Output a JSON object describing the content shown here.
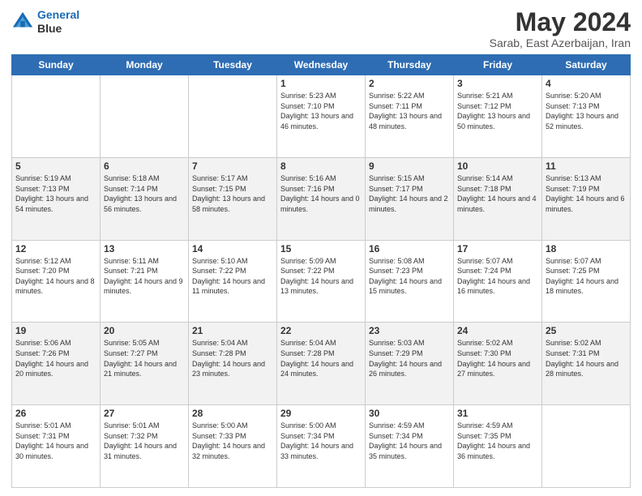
{
  "logo": {
    "line1": "General",
    "line2": "Blue"
  },
  "title": "May 2024",
  "subtitle": "Sarab, East Azerbaijan, Iran",
  "days_header": [
    "Sunday",
    "Monday",
    "Tuesday",
    "Wednesday",
    "Thursday",
    "Friday",
    "Saturday"
  ],
  "weeks": [
    [
      {
        "day": "",
        "sunrise": "",
        "sunset": "",
        "daylight": ""
      },
      {
        "day": "",
        "sunrise": "",
        "sunset": "",
        "daylight": ""
      },
      {
        "day": "",
        "sunrise": "",
        "sunset": "",
        "daylight": ""
      },
      {
        "day": "1",
        "sunrise": "Sunrise: 5:23 AM",
        "sunset": "Sunset: 7:10 PM",
        "daylight": "Daylight: 13 hours and 46 minutes."
      },
      {
        "day": "2",
        "sunrise": "Sunrise: 5:22 AM",
        "sunset": "Sunset: 7:11 PM",
        "daylight": "Daylight: 13 hours and 48 minutes."
      },
      {
        "day": "3",
        "sunrise": "Sunrise: 5:21 AM",
        "sunset": "Sunset: 7:12 PM",
        "daylight": "Daylight: 13 hours and 50 minutes."
      },
      {
        "day": "4",
        "sunrise": "Sunrise: 5:20 AM",
        "sunset": "Sunset: 7:13 PM",
        "daylight": "Daylight: 13 hours and 52 minutes."
      }
    ],
    [
      {
        "day": "5",
        "sunrise": "Sunrise: 5:19 AM",
        "sunset": "Sunset: 7:13 PM",
        "daylight": "Daylight: 13 hours and 54 minutes."
      },
      {
        "day": "6",
        "sunrise": "Sunrise: 5:18 AM",
        "sunset": "Sunset: 7:14 PM",
        "daylight": "Daylight: 13 hours and 56 minutes."
      },
      {
        "day": "7",
        "sunrise": "Sunrise: 5:17 AM",
        "sunset": "Sunset: 7:15 PM",
        "daylight": "Daylight: 13 hours and 58 minutes."
      },
      {
        "day": "8",
        "sunrise": "Sunrise: 5:16 AM",
        "sunset": "Sunset: 7:16 PM",
        "daylight": "Daylight: 14 hours and 0 minutes."
      },
      {
        "day": "9",
        "sunrise": "Sunrise: 5:15 AM",
        "sunset": "Sunset: 7:17 PM",
        "daylight": "Daylight: 14 hours and 2 minutes."
      },
      {
        "day": "10",
        "sunrise": "Sunrise: 5:14 AM",
        "sunset": "Sunset: 7:18 PM",
        "daylight": "Daylight: 14 hours and 4 minutes."
      },
      {
        "day": "11",
        "sunrise": "Sunrise: 5:13 AM",
        "sunset": "Sunset: 7:19 PM",
        "daylight": "Daylight: 14 hours and 6 minutes."
      }
    ],
    [
      {
        "day": "12",
        "sunrise": "Sunrise: 5:12 AM",
        "sunset": "Sunset: 7:20 PM",
        "daylight": "Daylight: 14 hours and 8 minutes."
      },
      {
        "day": "13",
        "sunrise": "Sunrise: 5:11 AM",
        "sunset": "Sunset: 7:21 PM",
        "daylight": "Daylight: 14 hours and 9 minutes."
      },
      {
        "day": "14",
        "sunrise": "Sunrise: 5:10 AM",
        "sunset": "Sunset: 7:22 PM",
        "daylight": "Daylight: 14 hours and 11 minutes."
      },
      {
        "day": "15",
        "sunrise": "Sunrise: 5:09 AM",
        "sunset": "Sunset: 7:22 PM",
        "daylight": "Daylight: 14 hours and 13 minutes."
      },
      {
        "day": "16",
        "sunrise": "Sunrise: 5:08 AM",
        "sunset": "Sunset: 7:23 PM",
        "daylight": "Daylight: 14 hours and 15 minutes."
      },
      {
        "day": "17",
        "sunrise": "Sunrise: 5:07 AM",
        "sunset": "Sunset: 7:24 PM",
        "daylight": "Daylight: 14 hours and 16 minutes."
      },
      {
        "day": "18",
        "sunrise": "Sunrise: 5:07 AM",
        "sunset": "Sunset: 7:25 PM",
        "daylight": "Daylight: 14 hours and 18 minutes."
      }
    ],
    [
      {
        "day": "19",
        "sunrise": "Sunrise: 5:06 AM",
        "sunset": "Sunset: 7:26 PM",
        "daylight": "Daylight: 14 hours and 20 minutes."
      },
      {
        "day": "20",
        "sunrise": "Sunrise: 5:05 AM",
        "sunset": "Sunset: 7:27 PM",
        "daylight": "Daylight: 14 hours and 21 minutes."
      },
      {
        "day": "21",
        "sunrise": "Sunrise: 5:04 AM",
        "sunset": "Sunset: 7:28 PM",
        "daylight": "Daylight: 14 hours and 23 minutes."
      },
      {
        "day": "22",
        "sunrise": "Sunrise: 5:04 AM",
        "sunset": "Sunset: 7:28 PM",
        "daylight": "Daylight: 14 hours and 24 minutes."
      },
      {
        "day": "23",
        "sunrise": "Sunrise: 5:03 AM",
        "sunset": "Sunset: 7:29 PM",
        "daylight": "Daylight: 14 hours and 26 minutes."
      },
      {
        "day": "24",
        "sunrise": "Sunrise: 5:02 AM",
        "sunset": "Sunset: 7:30 PM",
        "daylight": "Daylight: 14 hours and 27 minutes."
      },
      {
        "day": "25",
        "sunrise": "Sunrise: 5:02 AM",
        "sunset": "Sunset: 7:31 PM",
        "daylight": "Daylight: 14 hours and 28 minutes."
      }
    ],
    [
      {
        "day": "26",
        "sunrise": "Sunrise: 5:01 AM",
        "sunset": "Sunset: 7:31 PM",
        "daylight": "Daylight: 14 hours and 30 minutes."
      },
      {
        "day": "27",
        "sunrise": "Sunrise: 5:01 AM",
        "sunset": "Sunset: 7:32 PM",
        "daylight": "Daylight: 14 hours and 31 minutes."
      },
      {
        "day": "28",
        "sunrise": "Sunrise: 5:00 AM",
        "sunset": "Sunset: 7:33 PM",
        "daylight": "Daylight: 14 hours and 32 minutes."
      },
      {
        "day": "29",
        "sunrise": "Sunrise: 5:00 AM",
        "sunset": "Sunset: 7:34 PM",
        "daylight": "Daylight: 14 hours and 33 minutes."
      },
      {
        "day": "30",
        "sunrise": "Sunrise: 4:59 AM",
        "sunset": "Sunset: 7:34 PM",
        "daylight": "Daylight: 14 hours and 35 minutes."
      },
      {
        "day": "31",
        "sunrise": "Sunrise: 4:59 AM",
        "sunset": "Sunset: 7:35 PM",
        "daylight": "Daylight: 14 hours and 36 minutes."
      },
      {
        "day": "",
        "sunrise": "",
        "sunset": "",
        "daylight": ""
      }
    ]
  ]
}
